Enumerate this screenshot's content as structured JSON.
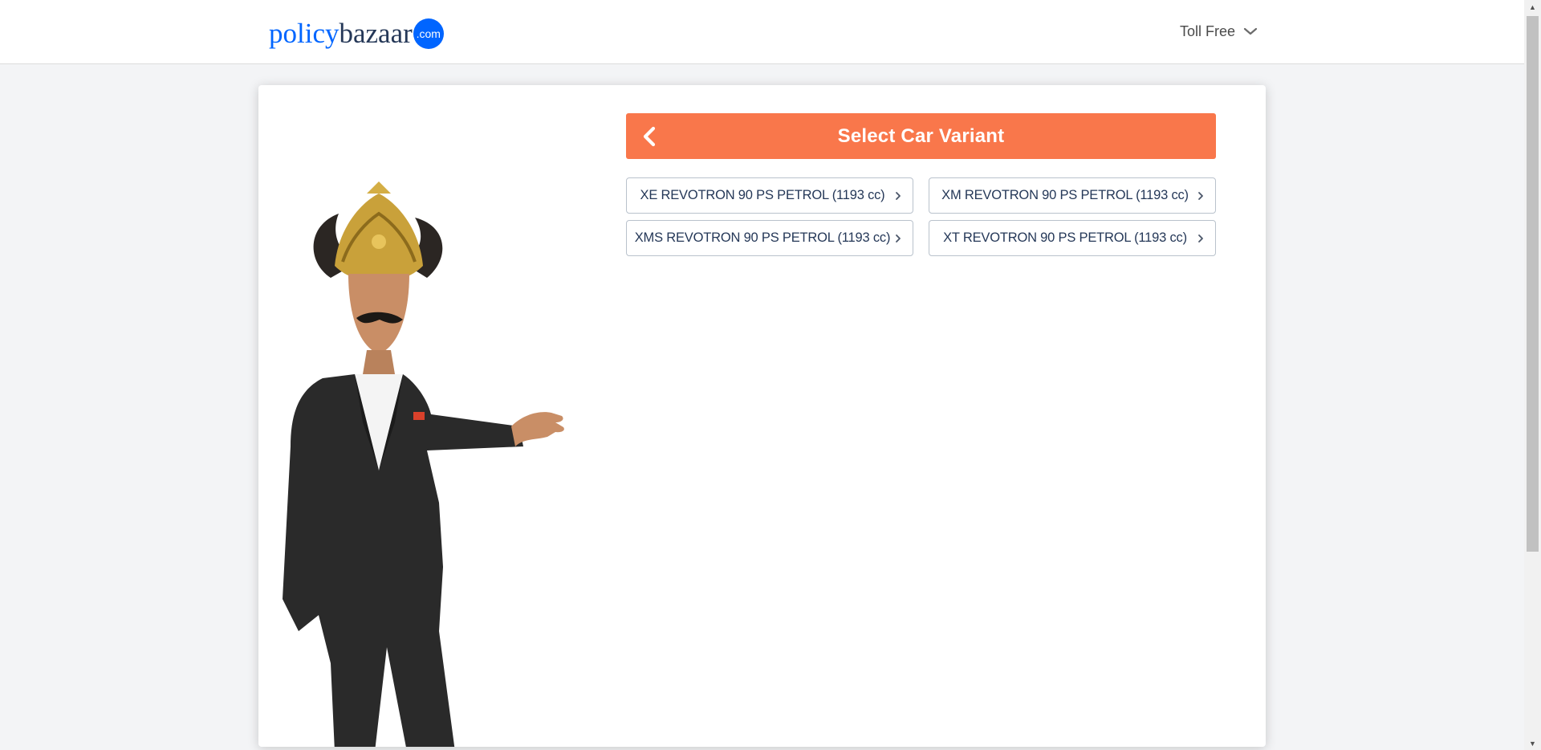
{
  "header": {
    "logo_part1": "policy",
    "logo_part2": "bazaar",
    "logo_badge": ".com",
    "toll_free_label": "Toll Free"
  },
  "main": {
    "title": "Select Car Variant",
    "variants": [
      {
        "label": "XE REVOTRON 90 PS PETROL (1193 cc)"
      },
      {
        "label": "XM REVOTRON 90 PS PETROL (1193 cc)"
      },
      {
        "label": "XMS REVOTRON 90 PS PETROL (1193 cc)"
      },
      {
        "label": "XT REVOTRON 90 PS PETROL (1193 cc)"
      }
    ]
  },
  "icons": {
    "back": "chevron-left-icon",
    "dropdown": "chevron-down-icon",
    "variant_arrow": "chevron-right-icon"
  },
  "colors": {
    "brand_blue": "#0065ff",
    "accent_orange": "#f9774b",
    "text_dark": "#253858"
  }
}
